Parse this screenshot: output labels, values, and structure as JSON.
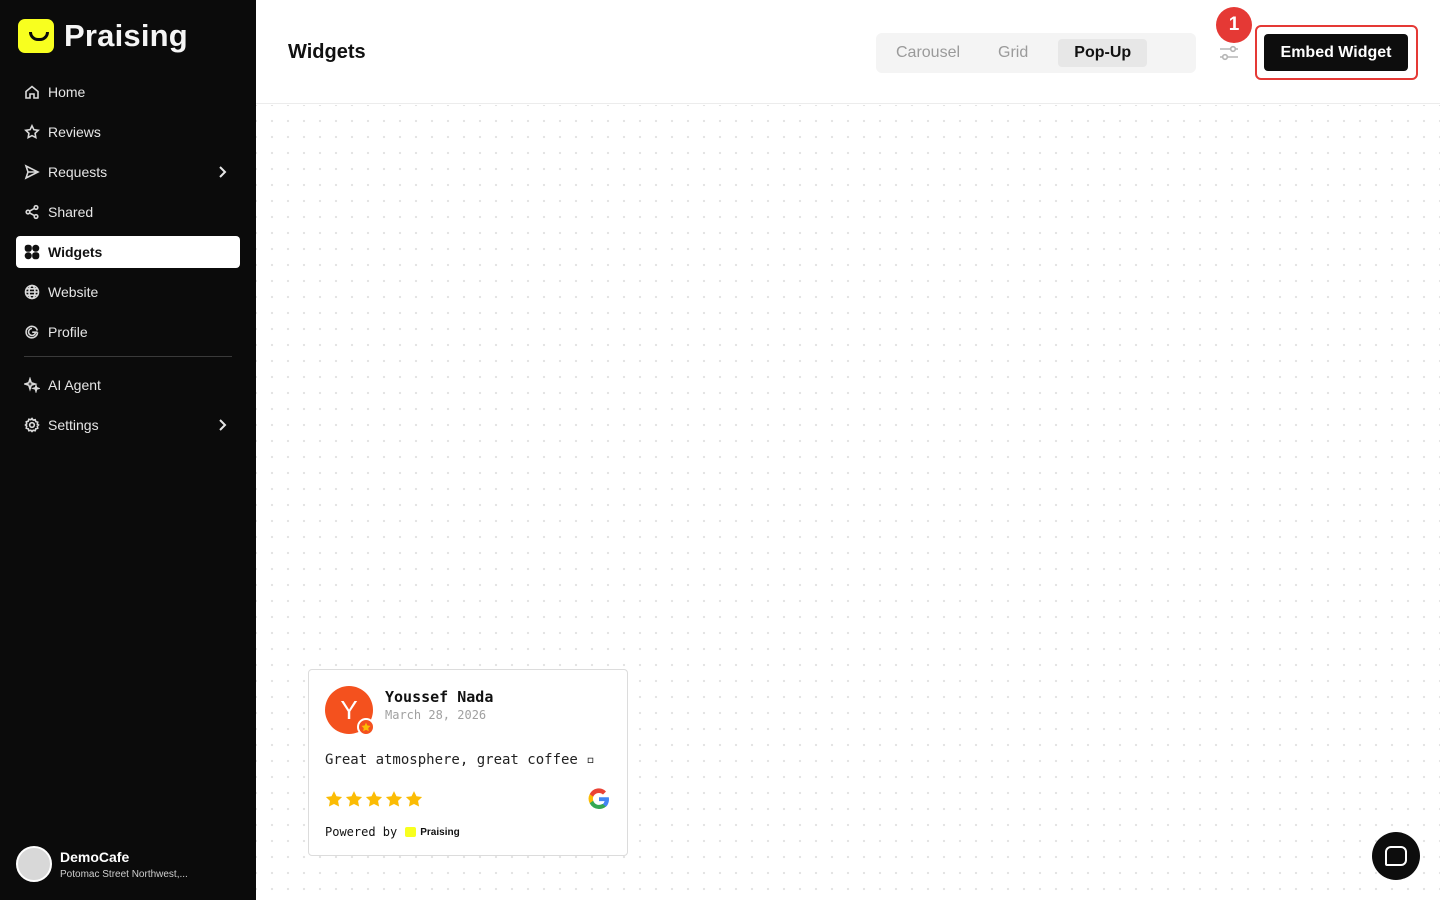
{
  "brand": {
    "name": "Praising"
  },
  "sidebar": {
    "items": [
      {
        "label": "Home",
        "icon": "home-icon"
      },
      {
        "label": "Reviews",
        "icon": "star-icon"
      },
      {
        "label": "Requests",
        "icon": "send-icon"
      },
      {
        "label": "Shared",
        "icon": "share-icon"
      },
      {
        "label": "Widgets",
        "icon": "widgets-icon"
      },
      {
        "label": "Website",
        "icon": "globe-icon"
      },
      {
        "label": "Profile",
        "icon": "google-icon"
      },
      {
        "label": "AI Agent",
        "icon": "sparkle-icon"
      },
      {
        "label": "Settings",
        "icon": "gear-icon"
      }
    ],
    "account": {
      "name": "DemoCafe",
      "address": "Potomac Street Northwest,..."
    }
  },
  "header": {
    "title": "Widgets",
    "tabs": [
      "Carousel",
      "Grid",
      "Pop-Up"
    ],
    "active_tab": "Pop-Up",
    "embed_label": "Embed Widget",
    "step_badge": "1"
  },
  "review": {
    "initial": "Y",
    "name": "Youssef Nada",
    "date": "March 28, 2026",
    "text": "Great atmosphere, great coffee ▫",
    "rating": 5,
    "source": "google-icon",
    "powered_by": "Powered by",
    "powered_brand": "Praising"
  },
  "colors": {
    "accent": "#f8ff1f",
    "highlight": "#e53935",
    "star": "#fbbc04",
    "avatar": "#f4511e"
  }
}
